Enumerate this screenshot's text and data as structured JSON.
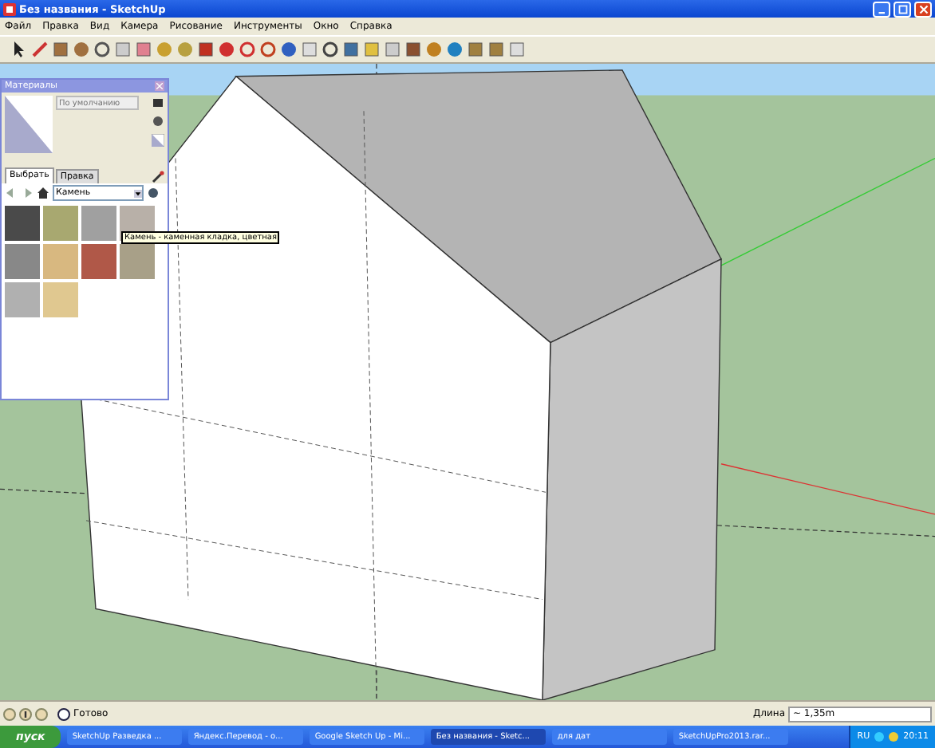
{
  "window": {
    "title": "Без названия - SketchUp"
  },
  "menu": [
    "Файл",
    "Правка",
    "Вид",
    "Камера",
    "Рисование",
    "Инструменты",
    "Окно",
    "Справка"
  ],
  "materials": {
    "title": "Материалы",
    "name_placeholder": "По умолчанию",
    "tabs": [
      {
        "label": "Выбрать",
        "selected": true
      },
      {
        "label": "Правка",
        "selected": false
      }
    ],
    "library": "Камень",
    "tooltip": "Камень - каменная кладка, цветная"
  },
  "status_bar": {
    "message": "Готово",
    "measure_label": "Длина",
    "measure_value": "~ 1,35m"
  },
  "taskbar": {
    "start": "пуск",
    "tasks": [
      {
        "label": "SketchUp Разведка ...",
        "selected": false
      },
      {
        "label": "Яндекс.Перевод - о...",
        "selected": false
      },
      {
        "label": "Google Sketch Up - Mi...",
        "selected": false
      },
      {
        "label": "Без названия - Sketc...",
        "selected": true
      },
      {
        "label": "для дат",
        "selected": false
      },
      {
        "label": "SketchUpPro2013.rar...",
        "selected": false
      }
    ],
    "language": "RU",
    "clock": "20:11"
  }
}
